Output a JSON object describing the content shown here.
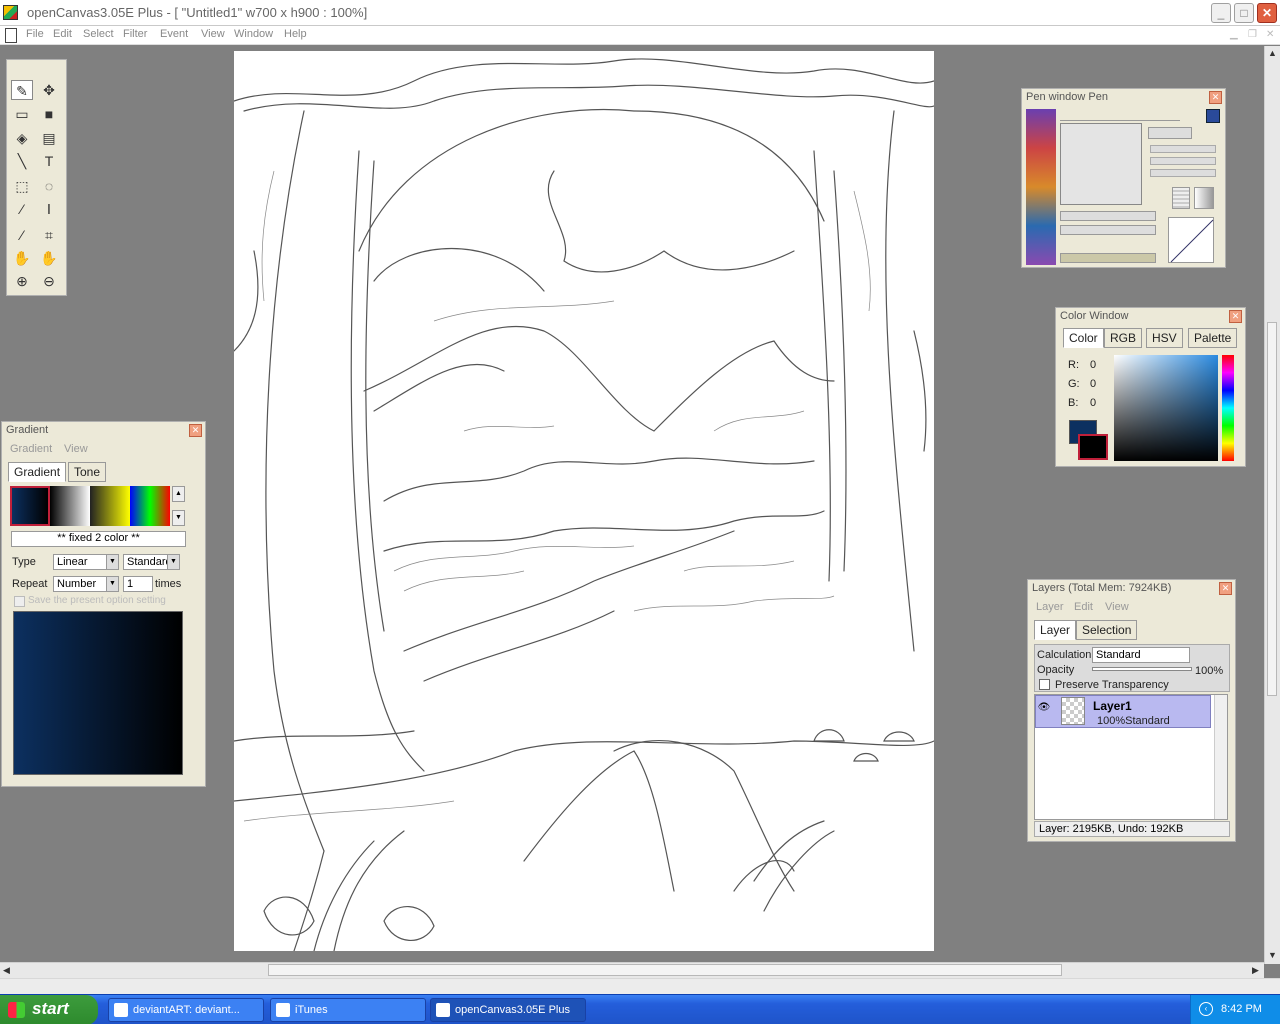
{
  "window": {
    "title": "openCanvas3.05E Plus - [ \"Untitled1\" w700 x h900 : 100%]",
    "min": "_",
    "max": "□",
    "close": "✕"
  },
  "menu": [
    "File",
    "Edit",
    "Select",
    "Filter",
    "Event",
    "View",
    "Window",
    "Help"
  ],
  "pen_window": {
    "title": "Pen window  Pen"
  },
  "color_window": {
    "title": "Color Window",
    "tabs": [
      "Color",
      "RGB",
      "HSV",
      "Palette"
    ],
    "r_label": "R:",
    "r": "0",
    "g_label": "G:",
    "g": "0",
    "b_label": "B:",
    "b": "0",
    "foreground": "#0c3060",
    "background": "#000000"
  },
  "gradient": {
    "title": "Gradient",
    "menu": [
      "Gradient",
      "View"
    ],
    "tabs": [
      "Gradient",
      "Tone"
    ],
    "preset_name": "** fixed 2 color **",
    "type_label": "Type",
    "type_value": "Linear",
    "type2_value": "Standard",
    "repeat_label": "Repeat",
    "repeat_value": "Number",
    "repeat_count": "1",
    "times": "times",
    "save_option": "Save the present option setting"
  },
  "layers": {
    "title": "Layers (Total Mem: 7924KB)",
    "menu": [
      "Layer",
      "Edit",
      "View"
    ],
    "tabs": [
      "Layer",
      "Selection"
    ],
    "calc_label": "Calculation",
    "calc_value": "Standard",
    "opacity_label": "Opacity",
    "opacity_value": "100%",
    "preserve": "Preserve Transparency",
    "layer_name": "Layer1",
    "layer_info": "100%Standard",
    "status": "Layer: 2195KB, Undo: 192KB"
  },
  "taskbar": {
    "start": "start",
    "tasks": [
      "deviantART: deviant...",
      "iTunes",
      "openCanvas3.05E Plus"
    ],
    "clock": "8:42 PM"
  }
}
